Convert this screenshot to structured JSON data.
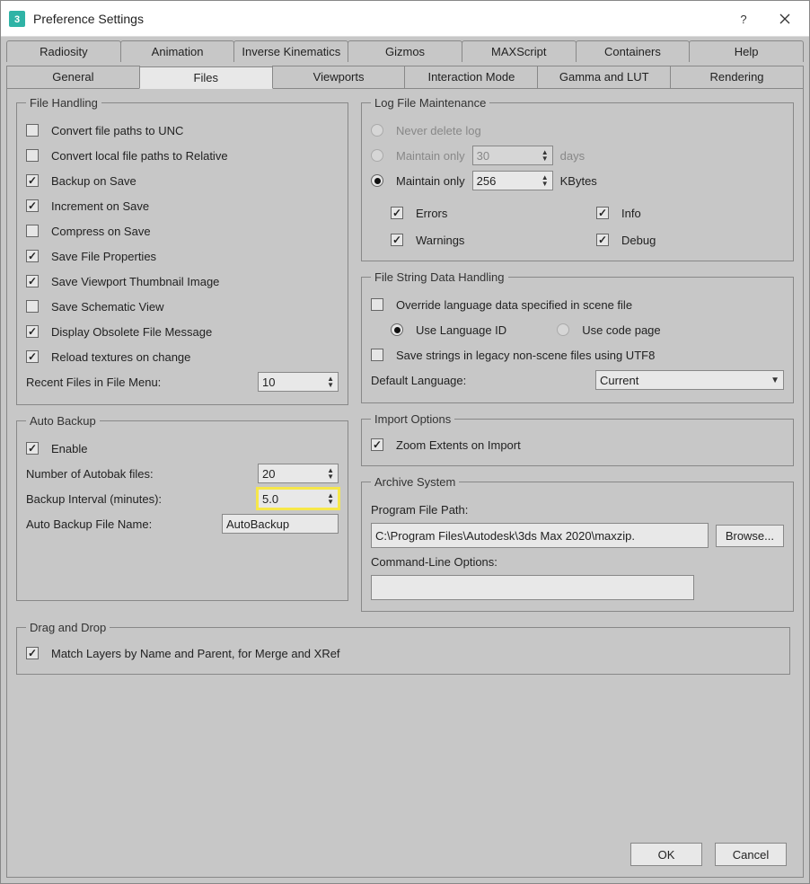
{
  "window": {
    "title": "Preference Settings"
  },
  "tabs_top": [
    "Radiosity",
    "Animation",
    "Inverse Kinematics",
    "Gizmos",
    "MAXScript",
    "Containers",
    "Help"
  ],
  "tabs_bottom": [
    "General",
    "Files",
    "Viewports",
    "Interaction Mode",
    "Gamma and LUT",
    "Rendering"
  ],
  "active_tab": "Files",
  "file_handling": {
    "legend": "File Handling",
    "convert_unc": "Convert file paths to UNC",
    "convert_relative": "Convert local file paths to Relative",
    "backup_on_save": "Backup on Save",
    "increment_on_save": "Increment on Save",
    "compress_on_save": "Compress on Save",
    "save_file_properties": "Save File Properties",
    "save_viewport_thumb": "Save Viewport Thumbnail Image",
    "save_schematic_view": "Save Schematic View",
    "display_obsolete": "Display Obsolete File Message",
    "reload_textures": "Reload textures on change",
    "recent_files_label": "Recent Files in File Menu:",
    "recent_files_value": "10"
  },
  "auto_backup": {
    "legend": "Auto Backup",
    "enable": "Enable",
    "num_files_label": "Number of Autobak files:",
    "num_files_value": "20",
    "interval_label": "Backup Interval (minutes):",
    "interval_value": "5.0",
    "filename_label": "Auto Backup File Name:",
    "filename_value": "AutoBackup"
  },
  "log_maint": {
    "legend": "Log File Maintenance",
    "never_delete": "Never delete log",
    "maintain_only_days_label": "Maintain only",
    "maintain_only_days_value": "30",
    "days_suffix": "days",
    "maintain_only_kb_label": "Maintain only",
    "maintain_only_kb_value": "256",
    "kb_suffix": "KBytes",
    "errors": "Errors",
    "warnings": "Warnings",
    "info": "Info",
    "debug": "Debug"
  },
  "file_string": {
    "legend": "File String Data Handling",
    "override_lang": "Override language data specified in scene file",
    "use_lang_id": "Use Language ID",
    "use_code_page": "Use code page",
    "save_utf8": "Save strings in legacy non-scene files using UTF8",
    "default_lang_label": "Default Language:",
    "default_lang_value": "Current"
  },
  "import_opts": {
    "legend": "Import Options",
    "zoom_extents": "Zoom Extents on Import"
  },
  "archive": {
    "legend": "Archive System",
    "program_path_label": "Program File Path:",
    "program_path_value": "C:\\Program Files\\Autodesk\\3ds Max 2020\\maxzip.",
    "browse": "Browse...",
    "cmd_label": "Command-Line Options:",
    "cmd_value": ""
  },
  "drag_drop": {
    "legend": "Drag and Drop",
    "match_layers": "Match Layers by Name and Parent, for Merge and XRef"
  },
  "footer": {
    "ok": "OK",
    "cancel": "Cancel"
  }
}
